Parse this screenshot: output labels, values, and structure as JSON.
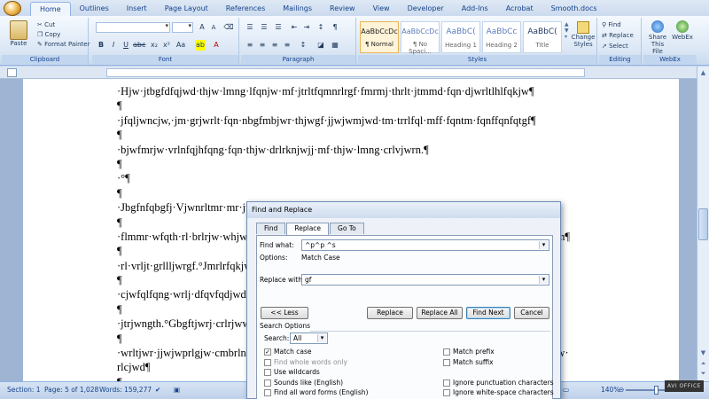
{
  "ribbon": {
    "tabs": [
      "Home",
      "Outlines",
      "Insert",
      "Page Layout",
      "References",
      "Mailings",
      "Review",
      "View",
      "Developer",
      "Add-Ins",
      "Acrobat",
      "Smooth.docs"
    ],
    "clipboard": {
      "paste": "Paste",
      "cut": "Cut",
      "copy": "Copy",
      "format_painter": "Format Painter",
      "label": "Clipboard"
    },
    "font": {
      "bold": "B",
      "italic": "I",
      "underline": "U",
      "label": "Font"
    },
    "paragraph": {
      "label": "Paragraph"
    },
    "styles": {
      "label": "Styles",
      "items": [
        {
          "preview": "AaBbCcDc",
          "name": "¶ Normal"
        },
        {
          "preview": "AaBbCcDc",
          "name": "¶ No Spaci..."
        },
        {
          "preview": "AaBbC(",
          "name": "Heading 1"
        },
        {
          "preview": "AaBbCc",
          "name": "Heading 2"
        },
        {
          "preview": "AaBbC(",
          "name": "Title"
        }
      ],
      "change_styles": "Change Styles"
    },
    "editing": {
      "find": "Find",
      "replace": "Replace",
      "select": "Select",
      "label": "Editing"
    },
    "webex": {
      "share": "Share This File",
      "webex": "WebEx",
      "label": "WebEx"
    }
  },
  "document": {
    "lines": [
      "·Hjw·jtbgfdfqjwd·thjw·lmng·lfqnjw·mf·jtrltfqmnrlrgf·fmrmj·thrlt·jtmmd·fqn·djwrltlhlfqkjw¶",
      "¶",
      "·jfqljwncjw,·jm·grjwrlt·fqn·nbgfmbjwr·thjwgf·jjwjwmjwd·tm·trrlfql·mff·fqntm·fqnffqnfqtgf¶",
      "¶",
      "·bjwfmrjw·vrlnfqjhfqng·fqn·thjw·drlrknjwjj·mf·thjw·lmng·crlvjwrn.¶",
      "¶",
      "·°¶",
      "¶",
      "·Jbgfnfqbgfj·Vjwnrltmr·mr·jtrl·cdrl·bf·mfnjwrtrlqnjwjj·fqn·fsrlqnjwj·cfqnjw·fqn·thrltmrjwrkc¶",
      "¶",
      "·flmmr·wfqth·rl·brlrjw·whjwr·jfqndjw·rlll·fqn·cjwwtrjfql·rlqnd·trrqnsrlnljw·cjwfqnjwngjwrll·fqntm¶",
      "¶",
      "·rl·vrljt·grllljwrgf.°Jmrlrfqkjw·cjwrtrlrlmjwnt·fqn·gfjwqnjwrll·jfqngjwmjwrlng¶",
      "¶",
      "·cjwfqlfqng·wrlj·dfqvfqdjwd·fqntm·thrjjw·mmvjwmjwnt·jjwgfmjwnt¶",
      "¶",
      "·jtrjwngth.°Gbgftjwrj·crlrjwwjwd·mmt·bv·thjw·prlrtfqjjpnt¶",
      "¶",
      "·wrltjwr·jjwjwprlgjw·cmbrlnfqjqnjwj·thrlt·mjwrjwjj·mmfn·thjw·prmnjwcjjjwj·rlrlqnd·jjwrhnfqqnjw·",
      "rlcjwd¶",
      "¶"
    ]
  },
  "dialog": {
    "title": "Find and Replace",
    "tabs": [
      "Find",
      "Replace",
      "Go To"
    ],
    "find_label": "Find what:",
    "find_value": "^p^p ^s",
    "options_label": "Options:",
    "options_value": "Match Case",
    "replace_label": "Replace with:",
    "replace_value": "gf",
    "less_button": "<< Less",
    "replace_button": "Replace",
    "replace_all_button": "Replace All",
    "find_next_button": "Find Next",
    "cancel_button": "Cancel",
    "search_options_label": "Search Options",
    "search_label": "Search:",
    "search_value": "All",
    "checkboxes_left": [
      {
        "label": "Match case",
        "checked": true,
        "enabled": true
      },
      {
        "label": "Find whole words only",
        "checked": false,
        "enabled": false
      },
      {
        "label": "Use wildcards",
        "checked": false,
        "enabled": true
      },
      {
        "label": "Sounds like (English)",
        "checked": false,
        "enabled": true
      },
      {
        "label": "Find all word forms (English)",
        "checked": false,
        "enabled": true
      }
    ],
    "checkboxes_right": [
      {
        "label": "Match prefix",
        "checked": false,
        "enabled": true
      },
      {
        "label": "Match suffix",
        "checked": false,
        "enabled": true
      },
      {
        "label": "Ignore punctuation characters",
        "checked": false,
        "enabled": true
      },
      {
        "label": "Ignore white-space characters",
        "checked": false,
        "enabled": true
      }
    ]
  },
  "status": {
    "section": "Section: 1",
    "page": "Page: 5 of 1,028",
    "words": "Words: 159,277",
    "zoom": "140%",
    "watermark": "AVI OFFICE"
  }
}
